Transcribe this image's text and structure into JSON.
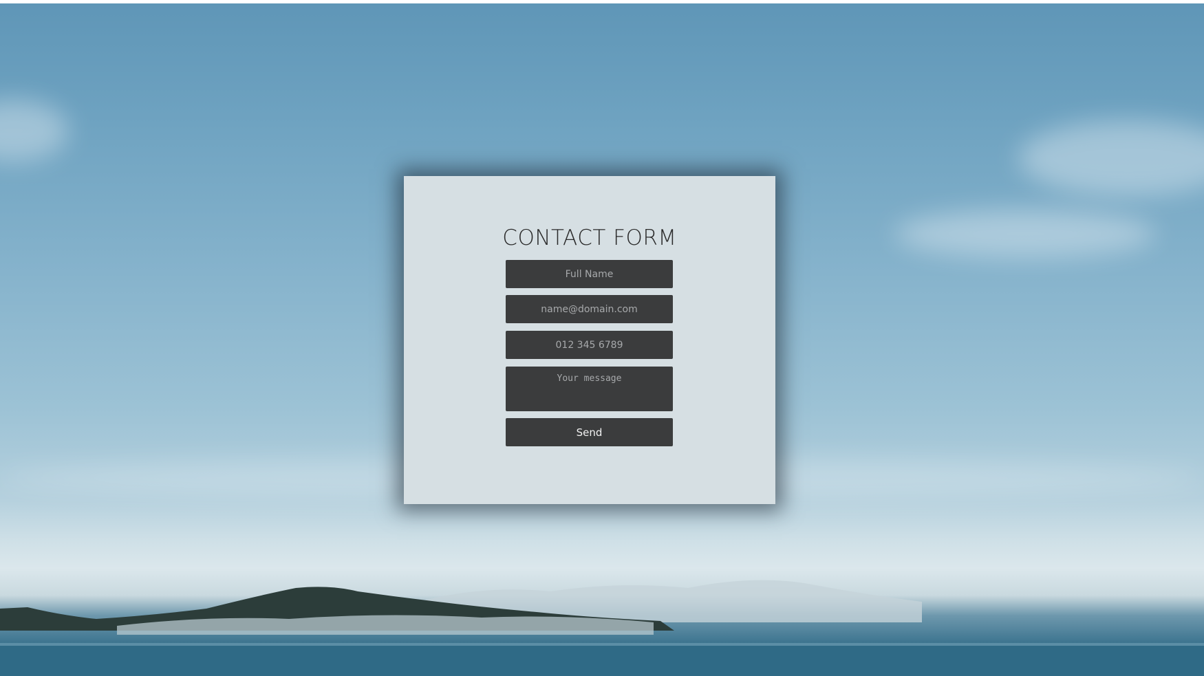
{
  "form": {
    "title": "CONTACT FORM",
    "fields": {
      "full_name": {
        "placeholder": "Full Name",
        "value": ""
      },
      "email": {
        "placeholder": "name@domain.com",
        "value": ""
      },
      "phone": {
        "placeholder": "012 345 6789",
        "value": ""
      },
      "message": {
        "placeholder": "Your message",
        "value": ""
      }
    },
    "send_label": "Send"
  },
  "colors": {
    "card_background": "#d6dfe3",
    "field_background": "#3b3c3d",
    "title_text": "#2a2a2a"
  }
}
